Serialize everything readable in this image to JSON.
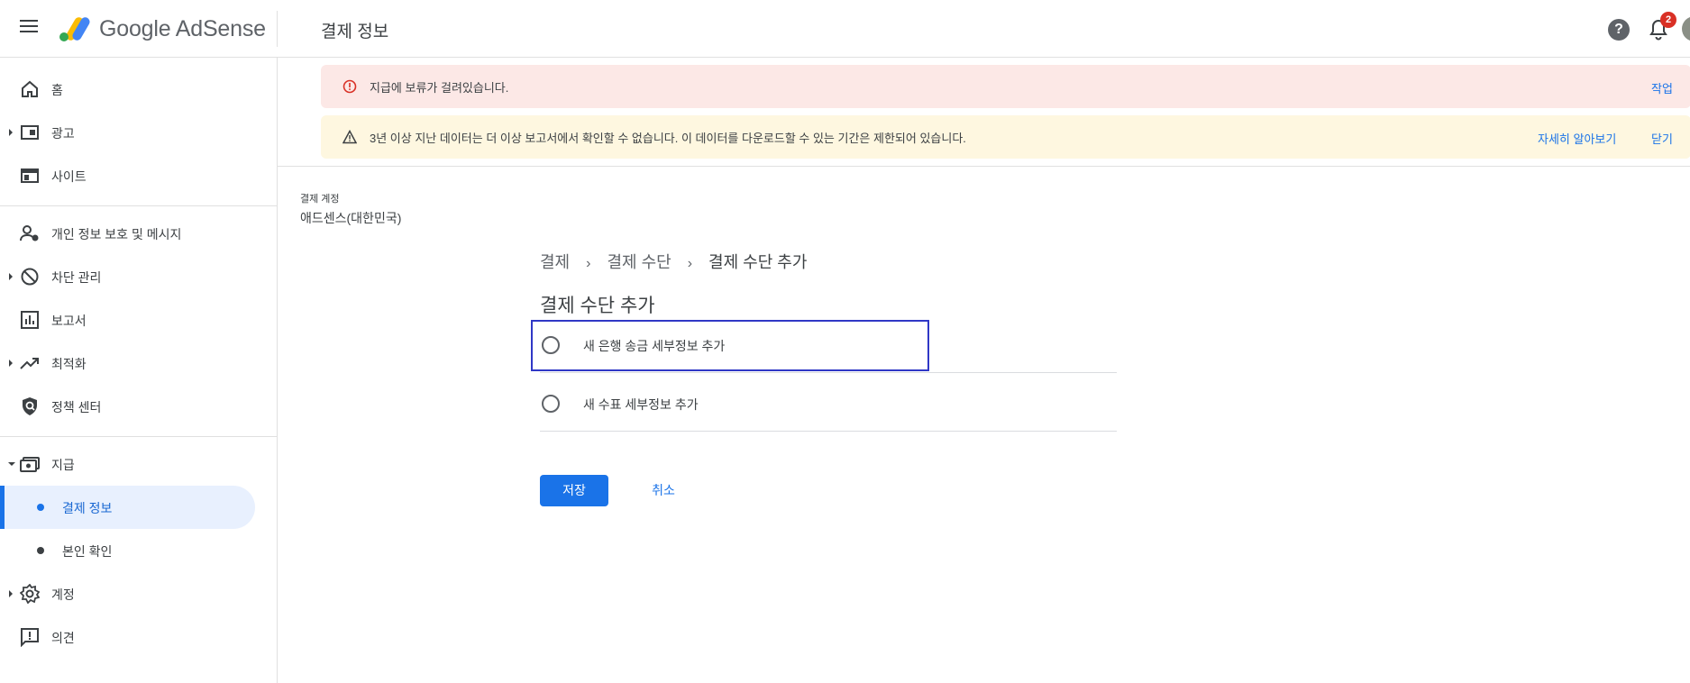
{
  "app": {
    "brand": "Google AdSense",
    "page_title": "결제 정보"
  },
  "header": {
    "notification_count": "2",
    "help_icon_glyph": "?"
  },
  "sidebar": {
    "items": [
      {
        "label": "홈",
        "icon": "home-icon"
      },
      {
        "label": "광고",
        "icon": "ads-icon"
      },
      {
        "label": "사이트",
        "icon": "sites-icon"
      },
      {
        "label": "개인 정보 보호 및 메시지",
        "icon": "privacy-messaging-icon"
      },
      {
        "label": "차단 관리",
        "icon": "block-icon"
      },
      {
        "label": "보고서",
        "icon": "reports-icon"
      },
      {
        "label": "최적화",
        "icon": "trending-up-icon"
      },
      {
        "label": "정책 센터",
        "icon": "policy-shield-icon"
      },
      {
        "label": "지급",
        "icon": "payments-icon"
      },
      {
        "label": "계정",
        "icon": "gear-icon"
      },
      {
        "label": "의견",
        "icon": "feedback-icon"
      }
    ],
    "sub_items": [
      {
        "label": "결제 정보",
        "active": true
      },
      {
        "label": "본인 확인",
        "active": false
      }
    ]
  },
  "banners": {
    "error": {
      "text": "지급에 보류가 걸려있습니다.",
      "action": "작업"
    },
    "warning": {
      "text": "3년 이상 지난 데이터는 더 이상 보고서에서 확인할 수 없습니다. 이 데이터를 다운로드할 수 있는 기간은 제한되어 있습니다.",
      "learn_more": "자세히 알아보기",
      "dismiss": "닫기"
    }
  },
  "account": {
    "label": "결제 계정",
    "name": "애드센스(대한민국)"
  },
  "breadcrumb": [
    "결제",
    "결제 수단",
    "결제 수단 추가"
  ],
  "section_title": "결제 수단 추가",
  "options": [
    {
      "label": "새 은행 송금 세부정보 추가",
      "selected": false
    },
    {
      "label": "새 수표 세부정보 추가",
      "selected": false
    }
  ],
  "actions": {
    "save": "저장",
    "cancel": "취소"
  },
  "colors": {
    "accent": "#1a73e8",
    "error_bg": "#fce8e6",
    "warning_bg": "#fef7e0",
    "error": "#d93025"
  }
}
